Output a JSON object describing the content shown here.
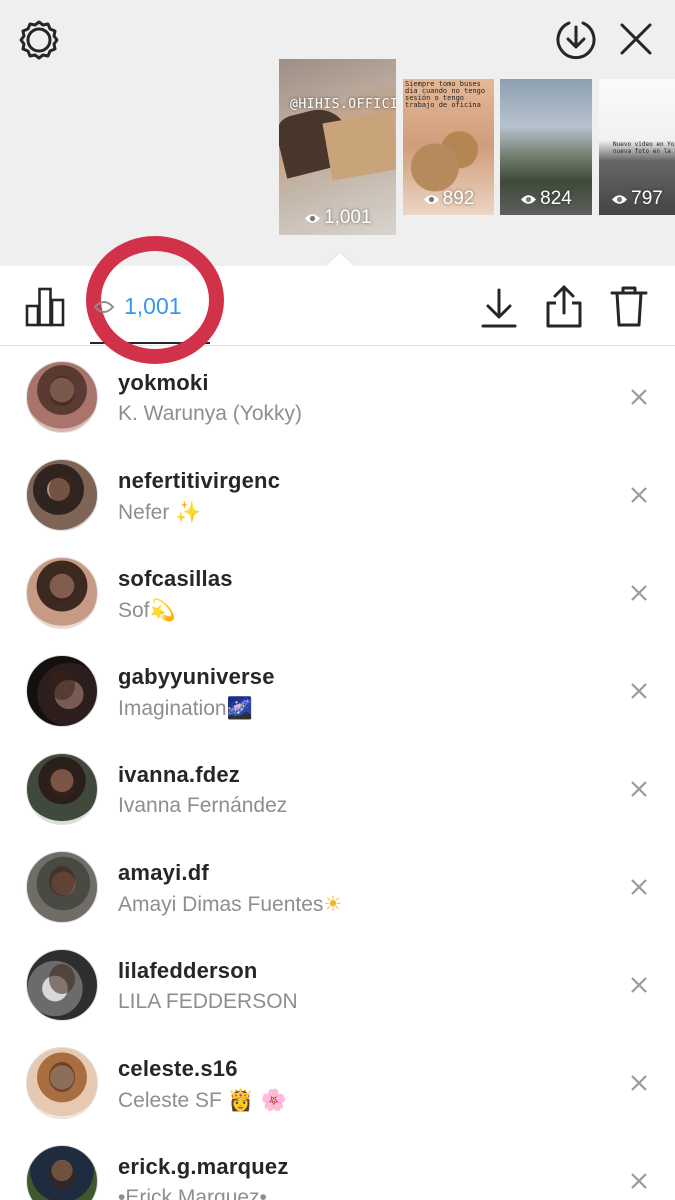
{
  "header": {
    "icons": {
      "settings": "gear-icon",
      "save": "download-circle-icon",
      "close": "close-icon"
    }
  },
  "story_thumbnails": [
    {
      "handle": "@HIHIS.OFFICIAL",
      "views": "1,001",
      "selected": true
    },
    {
      "caption": "Siempre tomo buses día cuando no tengo sesión o tengo trabajo de oficina",
      "views": "892"
    },
    {
      "views": "824"
    },
    {
      "caption": "Nuevo video en YouTube nueva foto en la bio",
      "views": "797"
    }
  ],
  "toolbar": {
    "viewer_count": "1,001",
    "icons": [
      "bar-chart-icon",
      "eye-icon",
      "download-icon",
      "share-icon",
      "trash-icon"
    ]
  },
  "annotation": {
    "color": "#d2314a"
  },
  "colors": {
    "accent": "#3897f0",
    "username": "#262626",
    "secondary": "#8e8e8e"
  },
  "viewers": [
    {
      "username": "yokmoki",
      "fullname": "K. Warunya (Yokky)",
      "emoji": ""
    },
    {
      "username": "nefertitivirgenc",
      "fullname": "Nefer",
      "emoji": "✨"
    },
    {
      "username": "sofcasillas",
      "fullname": "Sof",
      "emoji": "💫"
    },
    {
      "username": "gabyyuniverse",
      "fullname": "Imagination",
      "emoji": "🌌"
    },
    {
      "username": "ivanna.fdez",
      "fullname": "Ivanna Fernández",
      "emoji": ""
    },
    {
      "username": "amayi.df",
      "fullname": "Amayi Dimas Fuentes",
      "emoji": "☀"
    },
    {
      "username": "lilafedderson",
      "fullname": "LILA FEDDERSON",
      "emoji": ""
    },
    {
      "username": "celeste.s16",
      "fullname": "Celeste SF",
      "emoji": "👸 🌸"
    },
    {
      "username": "erick.g.marquez",
      "fullname": "•Erick Marquez•",
      "emoji": ""
    }
  ]
}
